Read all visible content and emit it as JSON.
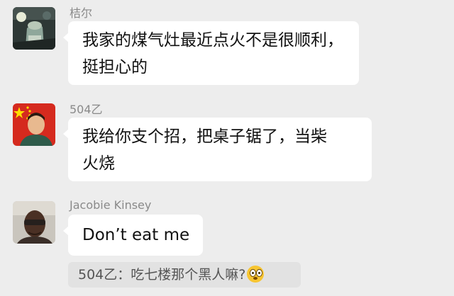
{
  "messages": [
    {
      "sender": "桔尔",
      "lines": [
        "我家的煤气灶最近点火不是很顺利，",
        "挺担心的"
      ]
    },
    {
      "sender": "504乙",
      "lines": [
        "我给你支个招，把桌子锯了，当柴",
        "火烧"
      ]
    },
    {
      "sender": "Jacobie Kinsey",
      "lines": [
        "Don’t eat me"
      ]
    }
  ],
  "quote": {
    "text": "504乙：吃七楼那个黑人嘛?",
    "emoji": "flushed-face"
  },
  "colors": {
    "background": "#ededed",
    "bubble": "#ffffff",
    "quote_background": "#e2e2e2",
    "sender_name": "#8a8a8a"
  }
}
